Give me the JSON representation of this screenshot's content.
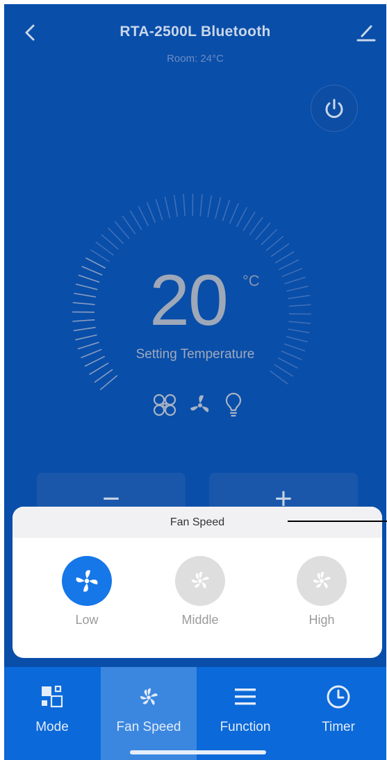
{
  "header": {
    "title": "RTA-2500L Bluetooth",
    "room": "Room: 24°C"
  },
  "thermostat": {
    "temperature": "20",
    "unit": "°C",
    "label": "Setting Temperature",
    "mode_icons": [
      "fan-speed-icon",
      "fan-icon",
      "light-bulb-icon"
    ]
  },
  "adjust": {
    "minus": "−",
    "plus": "+"
  },
  "fan_panel": {
    "title": "Fan Speed",
    "options": [
      {
        "label": "Low",
        "selected": true
      },
      {
        "label": "Middle",
        "selected": false
      },
      {
        "label": "High",
        "selected": false
      }
    ]
  },
  "nav": {
    "items": [
      {
        "label": "Mode",
        "icon": "mode-icon",
        "active": false
      },
      {
        "label": "Fan Speed",
        "icon": "fan-icon",
        "active": true
      },
      {
        "label": "Function",
        "icon": "menu-icon",
        "active": false
      },
      {
        "label": "Timer",
        "icon": "clock-icon",
        "active": false
      }
    ]
  },
  "colors": {
    "background": "#094ea9",
    "accent": "#1677e8",
    "nav": "#0b69d9",
    "nav_active": "#3b87e0",
    "inactive_option": "#dedede"
  }
}
